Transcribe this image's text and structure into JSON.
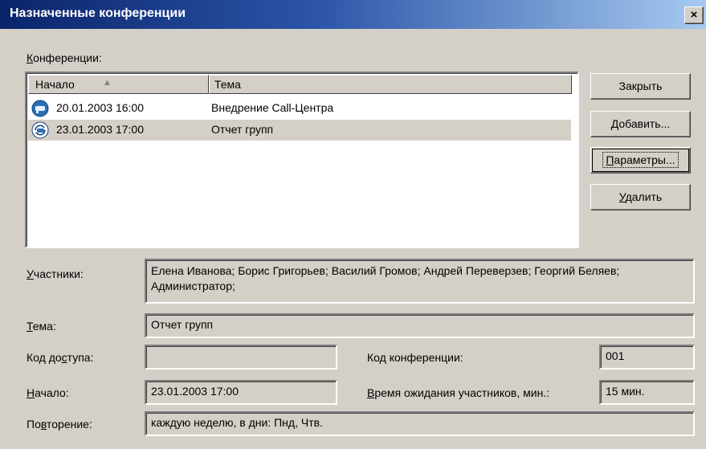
{
  "window": {
    "title": "Назначенные конференции",
    "close_glyph": "×"
  },
  "conferences_label": "Конференции:",
  "conferences_label_mnemonic": "К",
  "conferences_label_rest": "онференции:",
  "list": {
    "columns": [
      "Начало",
      "Тема"
    ],
    "sort_indicator": "▲",
    "rows": [
      {
        "start": "20.01.2003 16:00",
        "topic": "Внедрение Call-Центра",
        "icon": "conference-icon",
        "selected": false
      },
      {
        "start": "23.01.2003 17:00",
        "topic": "Отчет групп",
        "icon": "recurring-conference-icon",
        "selected": true
      }
    ]
  },
  "buttons": {
    "close": "Закрыть",
    "add": {
      "mn": "Д",
      "rest": "обавить..."
    },
    "params": {
      "mn": "П",
      "rest": "араметры..."
    },
    "delete": {
      "mn": "У",
      "rest": "далить"
    }
  },
  "details": {
    "participants_label": {
      "mn": "У",
      "rest": "частники:"
    },
    "participants_value": "Елена Иванова; Борис Григорьев; Василий Громов; Андрей Переверзев; Георгий Беляев; Администратор;",
    "topic_label": {
      "mn": "Т",
      "rest": "ема:"
    },
    "topic_value": "Отчет групп",
    "access_code_label": {
      "pre": "Код до",
      "mn": "с",
      "rest": "тупа:"
    },
    "access_code_value": "",
    "conf_code_label": {
      "pre": "Ко",
      "mn": "д",
      "rest": " конференции:"
    },
    "conf_code_value": "001",
    "start_label": {
      "mn": "Н",
      "rest": "ачало:"
    },
    "start_value": "23.01.2003 17:00",
    "wait_label": {
      "mn": "В",
      "rest": "ремя ожидания участников, мин.:"
    },
    "wait_value": "15 мин.",
    "repeat_label": {
      "pre": "По",
      "mn": "в",
      "rest": "торение:"
    },
    "repeat_value": "каждую неделю, в дни: Пнд, Чтв."
  },
  "colors": {
    "title_start": "#0a246a",
    "title_end": "#a6caf0",
    "face": "#d4d0c8"
  }
}
